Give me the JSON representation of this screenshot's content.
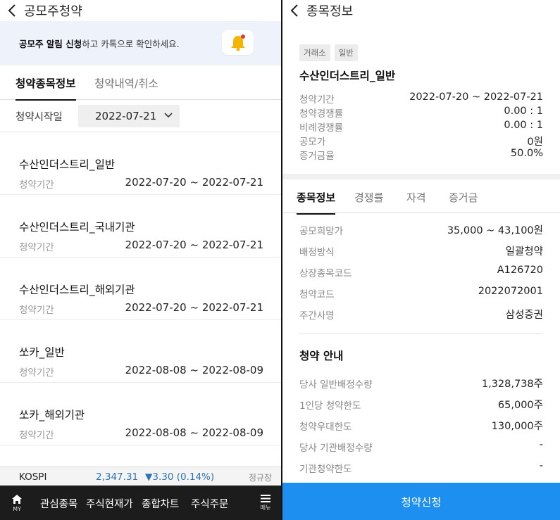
{
  "left": {
    "header": {
      "title": "공모주청약"
    },
    "banner": {
      "bold": "공모주 알림 신청",
      "rest": "하고 카톡으로 확인하세요."
    },
    "tabs": [
      {
        "label": "청약종목정보"
      },
      {
        "label": "청약내역/취소"
      }
    ],
    "date_filter": {
      "label": "청약시작일",
      "value": "2022-07-21"
    },
    "items": [
      {
        "name": "수산인더스트리_일반",
        "period_label": "청약기간",
        "period": "2022-07-20 ~ 2022-07-21"
      },
      {
        "name": "수산인더스트리_국내기관",
        "period_label": "청약기간",
        "period": "2022-07-20 ~ 2022-07-21"
      },
      {
        "name": "수산인더스트리_해외기관",
        "period_label": "청약기간",
        "period": "2022-07-20 ~ 2022-07-21"
      },
      {
        "name": "쏘카_일반",
        "period_label": "청약기간",
        "period": "2022-08-08 ~ 2022-08-09"
      },
      {
        "name": "쏘카_해외기관",
        "period_label": "청약기간",
        "period": "2022-08-08 ~ 2022-08-09"
      }
    ],
    "ticker": {
      "index": "KOSPI",
      "value": "2,347.31",
      "change": "▼3.30 (0.14%)",
      "session": "정규장"
    },
    "bottom_nav": {
      "home_label": "MY",
      "items": [
        "관심종목",
        "주식현재가",
        "종합차트",
        "주식주문"
      ],
      "menu_label": "메뉴"
    }
  },
  "right": {
    "header": {
      "title": "종목정보"
    },
    "chips": [
      "거래소",
      "일반"
    ],
    "name": "수산인더스트리_일반",
    "summary": [
      {
        "label": "청약기간",
        "value": "2022-07-20 ~ 2022-07-21"
      },
      {
        "label": "청약경쟁률",
        "value": "0.00 : 1"
      },
      {
        "label": "비례경쟁률",
        "value": "0.00 : 1"
      },
      {
        "label": "공모가",
        "value": "0원"
      },
      {
        "label": "증거금율",
        "value": "50.0%"
      }
    ],
    "tabs": [
      {
        "label": "종목정보"
      },
      {
        "label": "경쟁률"
      },
      {
        "label": "자격"
      },
      {
        "label": "증거금"
      }
    ],
    "info": [
      {
        "label": "공모희망가",
        "value": "35,000 ~ 43,100원"
      },
      {
        "label": "배정방식",
        "value": "일괄청약"
      },
      {
        "label": "상장종목코드",
        "value": "A126720"
      },
      {
        "label": "청약코드",
        "value": "2022072001"
      },
      {
        "label": "주간사명",
        "value": "삼성증권"
      }
    ],
    "guide_title": "청약 안내",
    "guide": [
      {
        "label": "당사 일반배정수량",
        "value": "1,328,738주"
      },
      {
        "label": "1인당 청약한도",
        "value": "65,000주"
      },
      {
        "label": "청약우대한도",
        "value": "130,000주"
      },
      {
        "label": "당사 기관배정수량",
        "value": "-"
      },
      {
        "label": "기관청약한도",
        "value": "-"
      }
    ],
    "apply_label": "청약신청"
  },
  "colors": {
    "accent": "#1d8ff0",
    "ticker_blue": "#2b73b7",
    "nav_bg": "#1c1c1c",
    "banner_bg": "#eef3fb"
  }
}
